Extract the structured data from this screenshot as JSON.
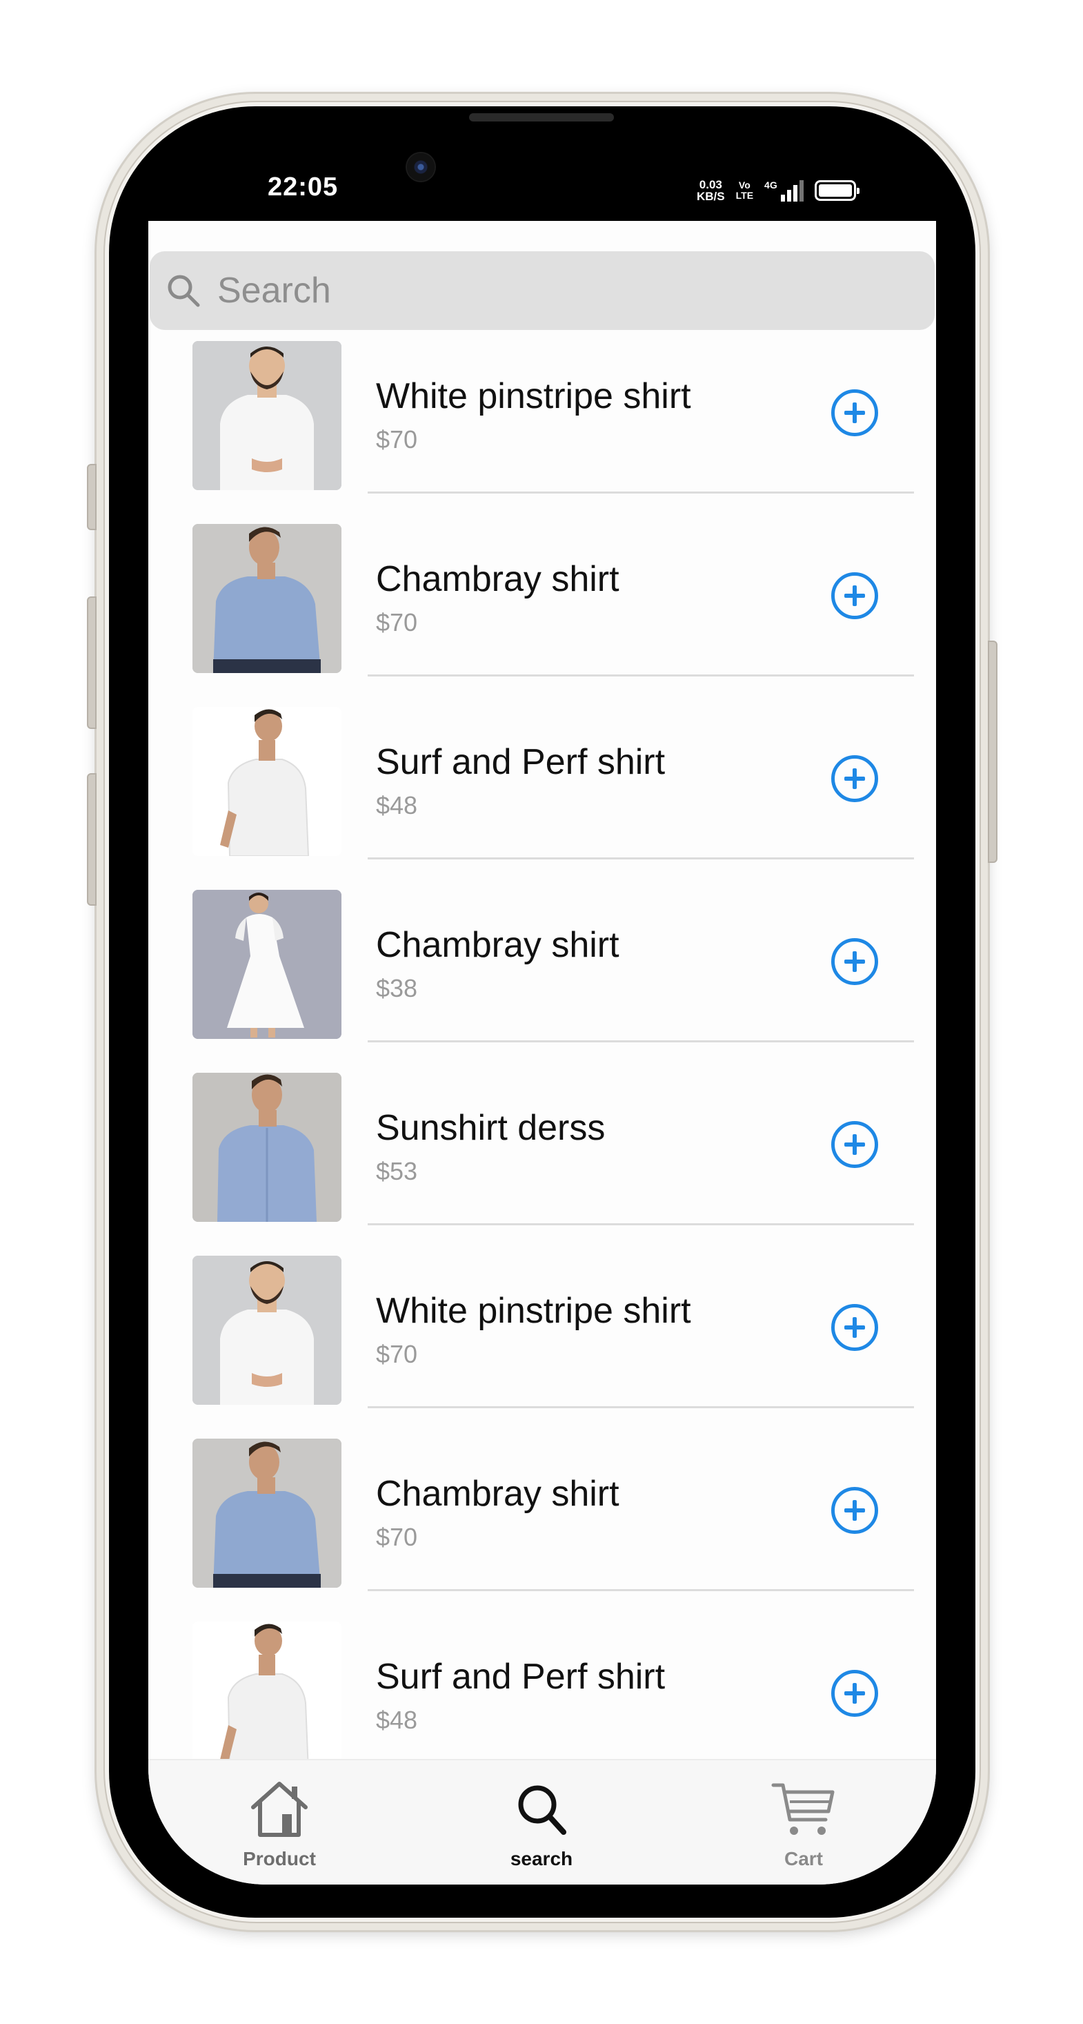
{
  "status_bar": {
    "time": "22:05",
    "net_speed_value": "0.03",
    "net_speed_unit": "KB/S",
    "volte_top": "Vo",
    "volte_bottom": "LTE",
    "network": "4G"
  },
  "search": {
    "placeholder": "Search"
  },
  "products": [
    {
      "name": "White pinstripe shirt",
      "price": "$70",
      "image": "man-white-shirt"
    },
    {
      "name": "Chambray shirt",
      "price": "$70",
      "image": "man-blue-shirt"
    },
    {
      "name": "Surf and Perf shirt",
      "price": "$48",
      "image": "man-white-shirt-back"
    },
    {
      "name": "Chambray shirt",
      "price": "$38",
      "image": "woman-white-dress"
    },
    {
      "name": "Sunshirt derss",
      "price": "$53",
      "image": "man-blue-shirt-front"
    },
    {
      "name": "White pinstripe shirt",
      "price": "$70",
      "image": "man-white-shirt"
    },
    {
      "name": "Chambray shirt",
      "price": "$70",
      "image": "man-blue-shirt"
    },
    {
      "name": "Surf and Perf shirt",
      "price": "$48",
      "image": "man-white-shirt-back"
    }
  ],
  "tabbar": {
    "product_label": "Product",
    "search_label": "search",
    "cart_label": "Cart"
  },
  "colors": {
    "accent": "#1e88e5",
    "search_bg": "#e0e0e0",
    "price_text": "#9a9a9a"
  }
}
